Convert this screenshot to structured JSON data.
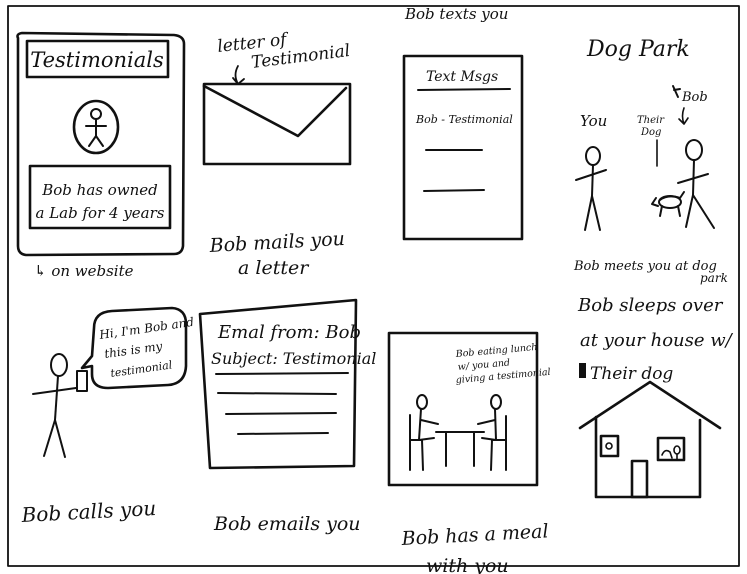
{
  "panels": {
    "website": {
      "title": "Testimonials",
      "body_line1": "Bob has owned",
      "body_line2": "a Lab for 4 years",
      "caption": "↳ on website"
    },
    "letter": {
      "header_line1": "letter of",
      "header_line2": "Testimonial",
      "caption_line1": "Bob mails you",
      "caption_line2": "a letter"
    },
    "texts": {
      "header": "Bob texts you",
      "phone_title": "Text Msgs",
      "phone_message": "Bob - Testimonial"
    },
    "dogpark": {
      "title": "Dog Park",
      "label_you": "You",
      "label_their_dog_1": "Their",
      "label_their_dog_2": "Dog",
      "label_bob": "Bob",
      "caption_line1": "Bob meets you at dog",
      "caption_line2": "park"
    },
    "call": {
      "bubble_line1": "Hi, I'm Bob and",
      "bubble_line2": "this is my",
      "bubble_line3": "testimonial",
      "caption": "Bob calls you"
    },
    "email": {
      "from_line": "Emal from: Bob",
      "subject_line": "Subject: Testimonial",
      "caption": "Bob emails you"
    },
    "meal": {
      "note_line1": "Bob eating lunch",
      "note_line2": "w/ you and",
      "note_line3": "giving a testimonial",
      "caption_line1": "Bob has a meal",
      "caption_line2": "with you"
    },
    "sleepover": {
      "caption_line1": "Bob sleeps over",
      "caption_line2": "at your house w/",
      "caption_line3": "Their dog"
    }
  }
}
